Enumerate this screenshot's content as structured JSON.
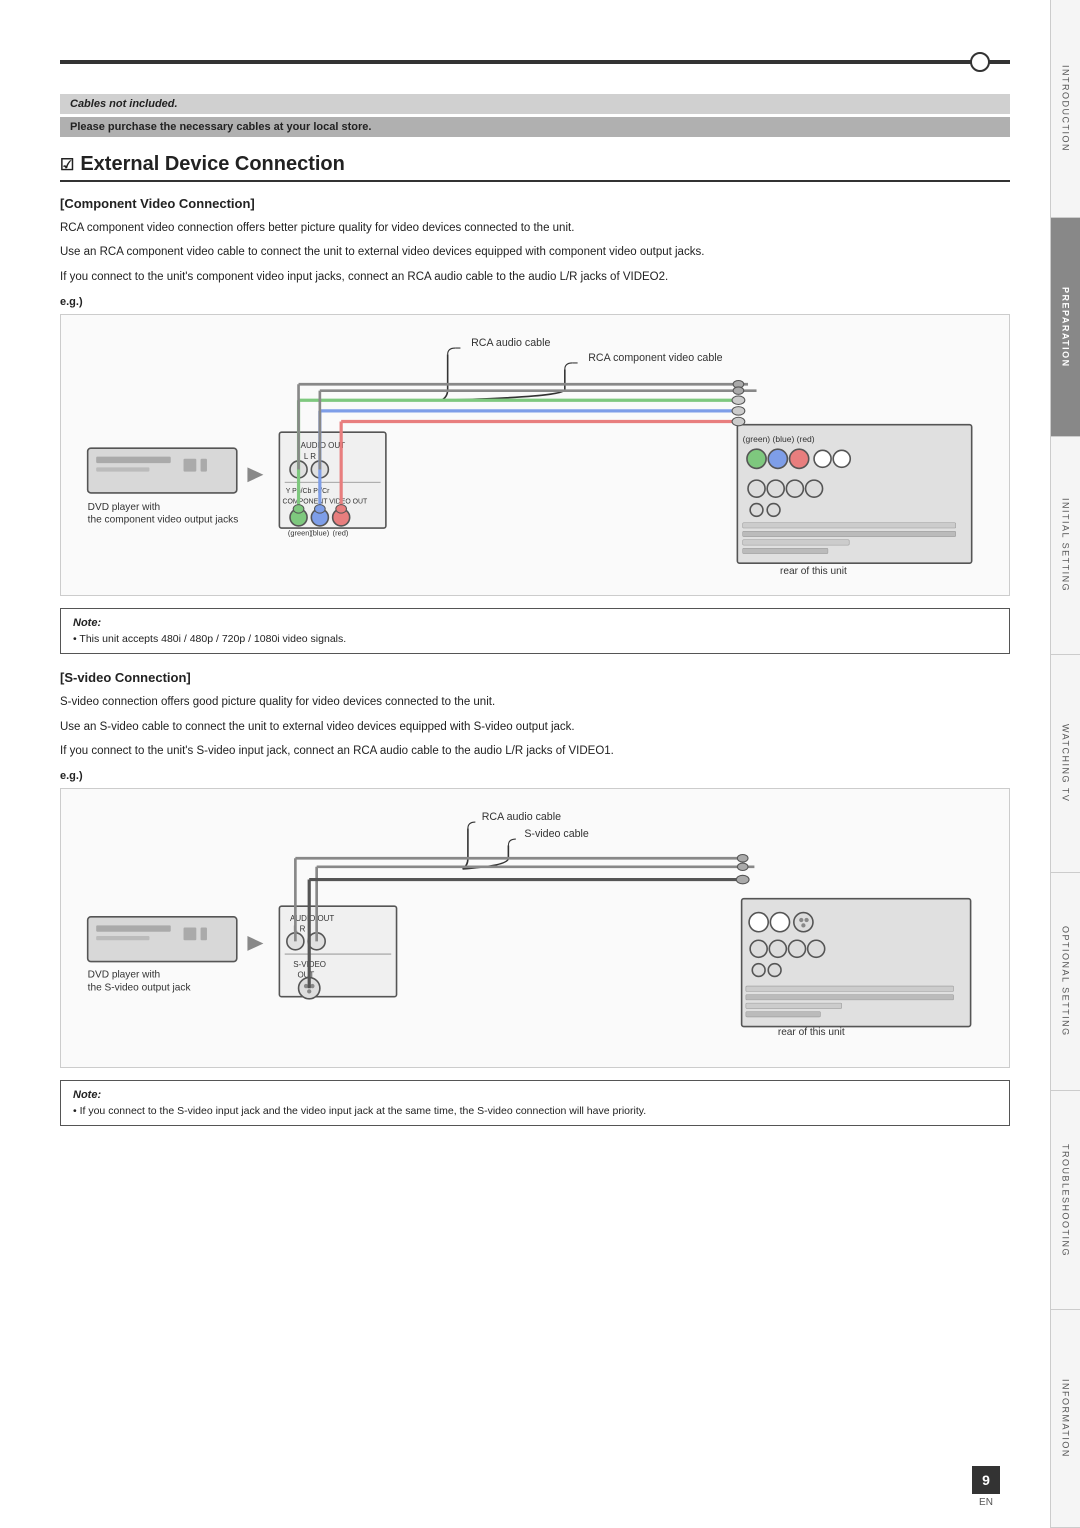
{
  "page": {
    "number": "9",
    "lang": "EN"
  },
  "topbar": {
    "circle": true
  },
  "cables_note": "Cables not included.",
  "purchase_note": "Please purchase the necessary cables at your local store.",
  "section": {
    "title": "External Device Connection",
    "checkbox": "☑"
  },
  "component_section": {
    "title": "[Component Video Connection]",
    "para1": "RCA component video connection offers better picture quality for video devices connected to the unit.",
    "para2": "Use an RCA component video cable to connect the unit to external video devices equipped with component video output jacks.",
    "para3": "If you connect to the unit's component video input jacks, connect an RCA audio cable to the audio L/R jacks of VIDEO2.",
    "eg_label": "e.g.)",
    "diagram": {
      "rca_audio_cable_label": "RCA audio cable",
      "rca_component_label": "RCA component video cable",
      "dvd_player_label": "DVD player with\nthe component video output jacks",
      "connector_label": "COMPONENT VIDEO OUT",
      "audio_out_label": "AUDIO OUT\nL         R",
      "pb_cb_label": "Pb/Cb",
      "pr_cr_label": "Pr/Cr",
      "y_label": "Y",
      "green_label": "(green)",
      "blue_label": "(blue)",
      "red_label": "(red)",
      "rear_label": "rear of this unit",
      "color_labels": "(green)(blue)(red)"
    }
  },
  "component_note": {
    "title": "Note:",
    "text": "This unit accepts 480i / 480p / 720p / 1080i video signals."
  },
  "svideo_section": {
    "title": "[S-video Connection]",
    "para1": "S-video connection offers good picture quality for video devices connected to the unit.",
    "para2": "Use an S-video cable to connect the unit to external video devices equipped with S-video output jack.",
    "para3": "If you connect to the unit's S-video input jack, connect an RCA audio cable to the audio L/R jacks of VIDEO1.",
    "eg_label": "e.g.)",
    "diagram": {
      "rca_audio_cable_label": "RCA audio cable",
      "svideo_cable_label": "S-video cable",
      "dvd_player_label": "DVD player with\nthe S-video output jack",
      "audio_out_label": "AUDIO OUT\nL         R",
      "svideo_out_label": "S-VIDEO\nOUT",
      "rear_label": "rear of this unit"
    }
  },
  "svideo_note": {
    "title": "Note:",
    "text": "If you connect to the S-video input jack and the video input jack at the same time, the S-video connection will have priority."
  },
  "side_tabs": [
    {
      "id": "introduction",
      "label": "INTRODUCTION",
      "active": false
    },
    {
      "id": "preparation",
      "label": "PREPARATION",
      "active": true
    },
    {
      "id": "initial-setting",
      "label": "INITIAL SETTING",
      "active": false
    },
    {
      "id": "watching-tv",
      "label": "WATCHING TV",
      "active": false
    },
    {
      "id": "optional-setting",
      "label": "OPTIONAL SETTING",
      "active": false
    },
    {
      "id": "troubleshooting",
      "label": "TROUBLESHOOTING",
      "active": false
    },
    {
      "id": "information",
      "label": "INFORMATION",
      "active": false
    }
  ]
}
